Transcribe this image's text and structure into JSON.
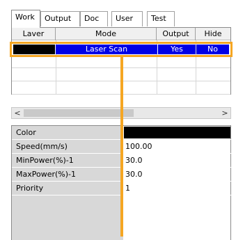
{
  "tabs": [
    {
      "label": "Work",
      "active": true
    },
    {
      "label": "Output",
      "active": false
    },
    {
      "label": "Doc",
      "active": false
    },
    {
      "label": "User",
      "active": false
    },
    {
      "label": "Test",
      "active": false
    }
  ],
  "layer_table": {
    "columns": [
      "Laver",
      "Mode",
      "Output",
      "Hide"
    ],
    "rows": [
      {
        "layer_color": "#000000",
        "mode": "Laser Scan",
        "output": "Yes",
        "hide": "No",
        "selected": true
      }
    ],
    "selection_color": "#0000e6"
  },
  "scrollbar": {
    "left_arrow": "<",
    "right_arrow": ">"
  },
  "properties": [
    {
      "label": "Color",
      "value": "",
      "swatch": "#000000"
    },
    {
      "label": "Speed(mm/s)",
      "value": "100.00"
    },
    {
      "label": "MinPower(%)-1",
      "value": "30.0"
    },
    {
      "label": "MaxPower(%)-1",
      "value": "30.0"
    },
    {
      "label": "Priority",
      "value": "1"
    }
  ],
  "annotation_color": "#f5a623"
}
